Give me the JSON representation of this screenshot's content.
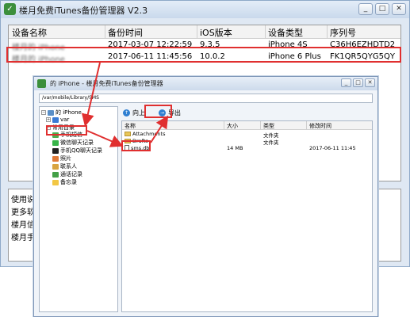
{
  "main_window": {
    "title": "楼月免费iTunes备份管理器 V2.3",
    "buttons": {
      "minimize": "_",
      "restore": "□",
      "close": "✕"
    },
    "table": {
      "columns": [
        "设备名称",
        "备份时间",
        "iOS版本",
        "设备类型",
        "序列号"
      ],
      "rows": [
        [
          "楼月的 iPhone",
          "2017-03-07 12:22:59",
          "9.3.5",
          "iPhone 4S",
          "C36H6EZHDTD2"
        ],
        [
          "楼月的 iPhone",
          "2017-06-11 11:45:56",
          "10.0.2",
          "iPhone 6 Plus",
          "FK1QR5QYG5QY"
        ]
      ]
    },
    "info_lines": [
      "使用说",
      "更多软",
      "楼月信",
      "楼月手"
    ]
  },
  "sub_window": {
    "title": "的 iPhone - 楼月免费iTunes备份管理器",
    "buttons": {
      "minimize": "_",
      "restore": "□",
      "close": "✕"
    },
    "path": "/var/mobile/Library/SMS",
    "tree": {
      "root": "的 iPhone",
      "items": [
        "var",
        "常用目录",
        "手机短信",
        "微信聊天记录",
        "手机QQ聊天记录",
        "照片",
        "联系人",
        "通话记录",
        "备忘录"
      ]
    },
    "toolbar": {
      "up": "向上",
      "export": "导出"
    },
    "filelist": {
      "columns": [
        "名称",
        "大小",
        "类型",
        "修改时间"
      ],
      "rows": [
        {
          "name": "Attachments",
          "size": "",
          "type": "文件夹",
          "modified": "",
          "kind": "folder"
        },
        {
          "name": "Drafts",
          "size": "",
          "type": "文件夹",
          "modified": "",
          "kind": "folder"
        },
        {
          "name": "sms.db",
          "size": "14 MB",
          "type": "",
          "modified": "2017-06-11 11:45",
          "kind": "file"
        }
      ]
    }
  },
  "colors": {
    "highlight": "#e02f2f",
    "accent": "#2f7fd1"
  }
}
